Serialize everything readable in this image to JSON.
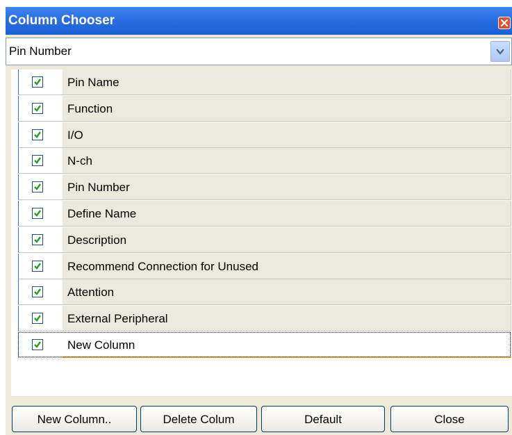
{
  "window": {
    "title": "Column Chooser"
  },
  "combo": {
    "value": "Pin Number"
  },
  "columns": [
    {
      "label": "Pin Name",
      "checked": true
    },
    {
      "label": "Function",
      "checked": true
    },
    {
      "label": "I/O",
      "checked": true
    },
    {
      "label": "N-ch",
      "checked": true
    },
    {
      "label": "Pin Number",
      "checked": true
    },
    {
      "label": "Define Name",
      "checked": true
    },
    {
      "label": "Description",
      "checked": true
    },
    {
      "label": "Recommend Connection for Unused",
      "checked": true
    },
    {
      "label": "Attention",
      "checked": true
    },
    {
      "label": "External Peripheral",
      "checked": true
    },
    {
      "label": "New Column",
      "checked": true,
      "selected": true
    }
  ],
  "buttons": {
    "new_column": "New Column..",
    "delete_column": "Delete Colum",
    "default": "Default",
    "close": "Close"
  },
  "colors": {
    "title_bar": "#2a6fe0",
    "checkmark": "#21a121",
    "selection_underline": "#e5a21a"
  }
}
